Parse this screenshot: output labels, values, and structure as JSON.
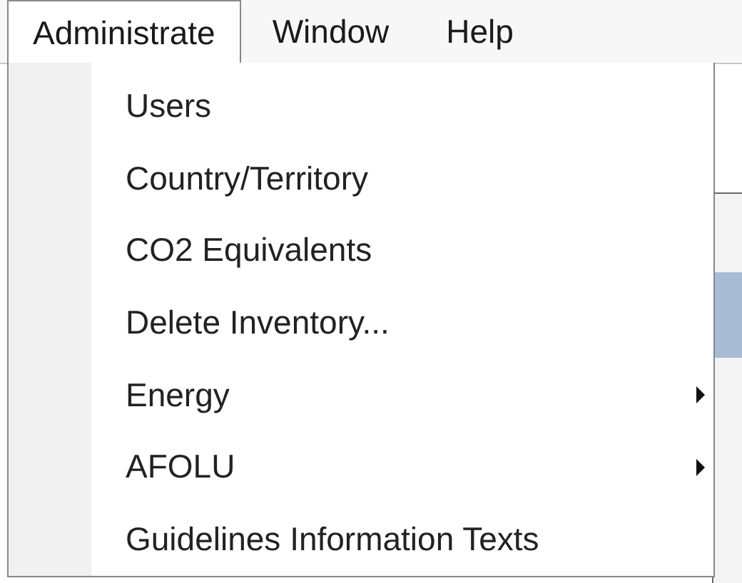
{
  "menu_bar": [
    {
      "label": "Administrate",
      "selected": true
    },
    {
      "label": "Window",
      "selected": false
    },
    {
      "label": "Help",
      "selected": false
    }
  ],
  "dropdown": [
    {
      "label": "Users",
      "kind": "command"
    },
    {
      "label": "Country/Territory",
      "kind": "command"
    },
    {
      "label": "CO2 Equivalents",
      "kind": "command"
    },
    {
      "label": "Delete Inventory...",
      "kind": "command"
    },
    {
      "label": "Energy",
      "kind": "submenu"
    },
    {
      "label": "AFOLU",
      "kind": "submenu"
    },
    {
      "label": "Guidelines Information Texts",
      "kind": "command"
    }
  ]
}
